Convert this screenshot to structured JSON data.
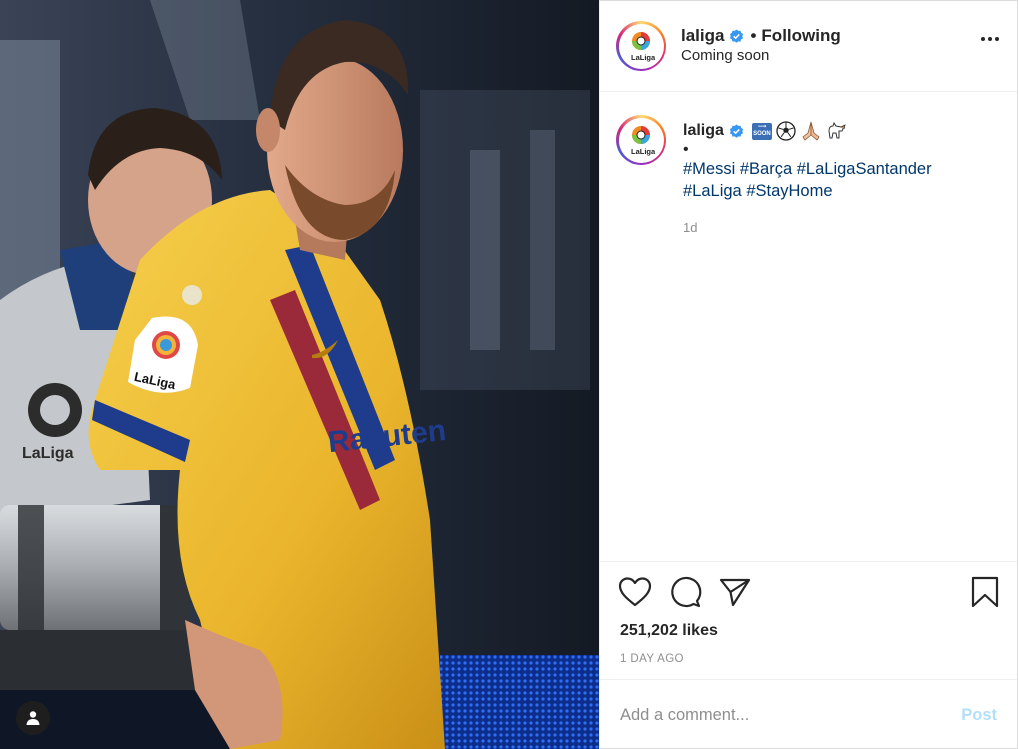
{
  "post": {
    "account": {
      "username": "laliga",
      "verified": true,
      "follow_state": "Following",
      "separator": "•",
      "location": "Coming soon",
      "logo_text": "LaLiga"
    },
    "caption": {
      "username": "laliga",
      "emojis": [
        "soon-arrow-emoji",
        "soccer-ball-emoji",
        "folded-hands-emoji",
        "dog-emoji"
      ],
      "soon_label": "SOON",
      "bullet": "•",
      "hashtags": [
        "#Messi",
        "#Barça",
        "#LaLigaSantander",
        "#LaLiga",
        "#StayHome"
      ],
      "time": "1d"
    },
    "photo": {
      "jersey_sponsor": "Rakuten",
      "sleeve_logo_text": "LaLiga",
      "bib_logo_text": "LaLiga"
    },
    "actions": {
      "icons": [
        "heart-icon",
        "comment-icon",
        "share-icon",
        "bookmark-icon"
      ],
      "likes": "251,202 likes",
      "date": "1 DAY AGO"
    },
    "comment": {
      "placeholder": "Add a comment...",
      "post_label": "Post"
    }
  },
  "colors": {
    "link": "#00376b",
    "verified": "#3897f0",
    "muted": "#8e8e8e",
    "post_disabled": "#b2dffc",
    "jersey_yellow": "#f2c23a"
  }
}
